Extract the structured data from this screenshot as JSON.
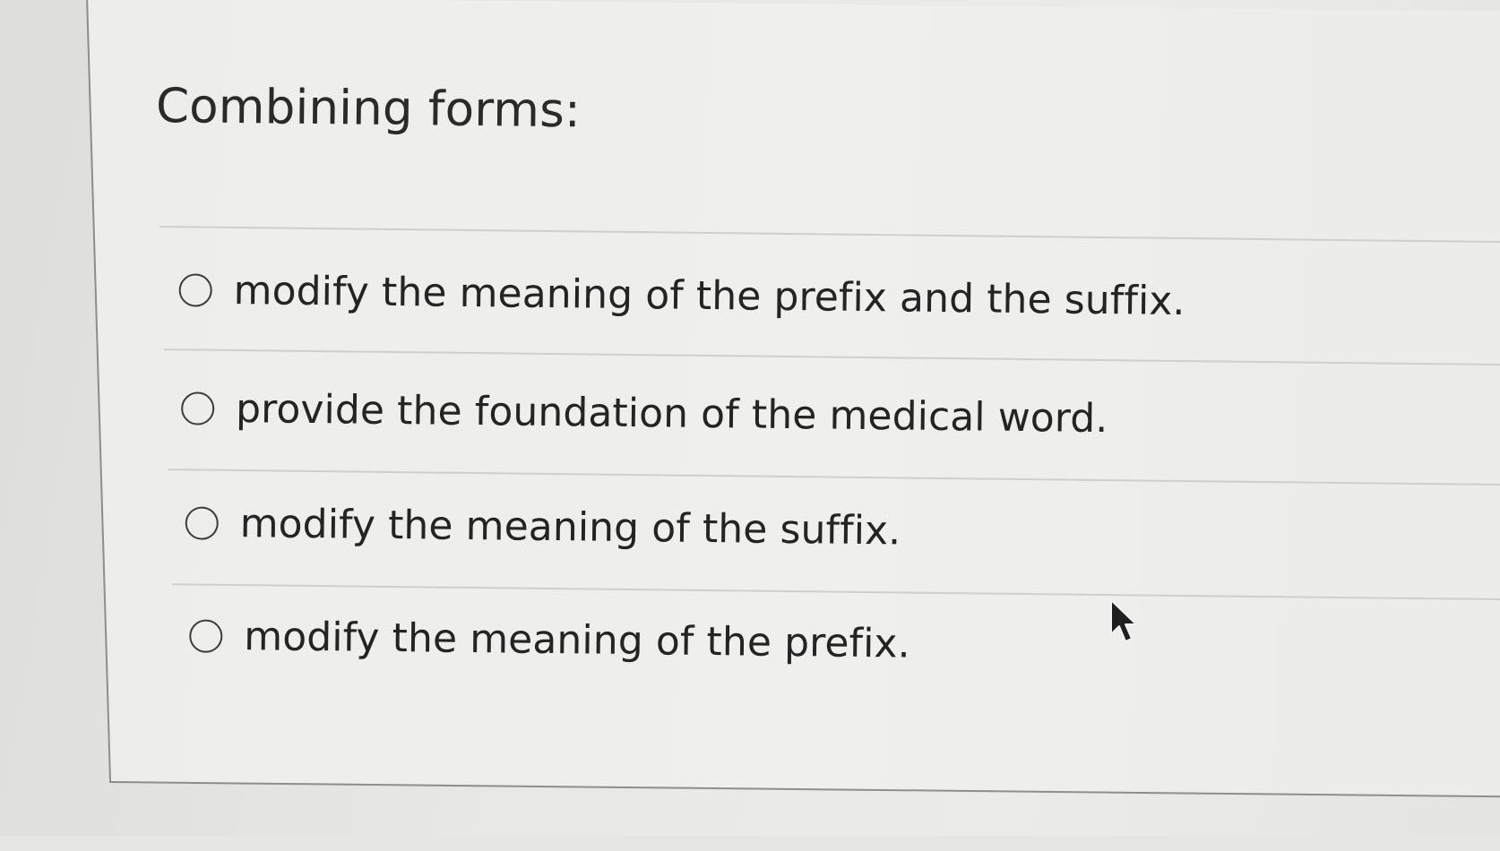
{
  "question": {
    "title": "Combining forms:"
  },
  "options": [
    {
      "label": "modify the meaning of the prefix and the suffix.",
      "selected": false
    },
    {
      "label": "provide the foundation of the medical word.",
      "selected": false
    },
    {
      "label": "modify the meaning of the suffix.",
      "selected": false
    },
    {
      "label": "modify the meaning of the prefix.",
      "selected": false
    }
  ],
  "colors": {
    "background": "#e6e6e4",
    "card": "#eeeeec",
    "text": "#2a2a2a",
    "divider": "#cfcfcd",
    "border": "#8e8e8c"
  },
  "icons": {
    "radio": "radio-button-unselected-icon",
    "cursor": "mouse-pointer-icon"
  }
}
